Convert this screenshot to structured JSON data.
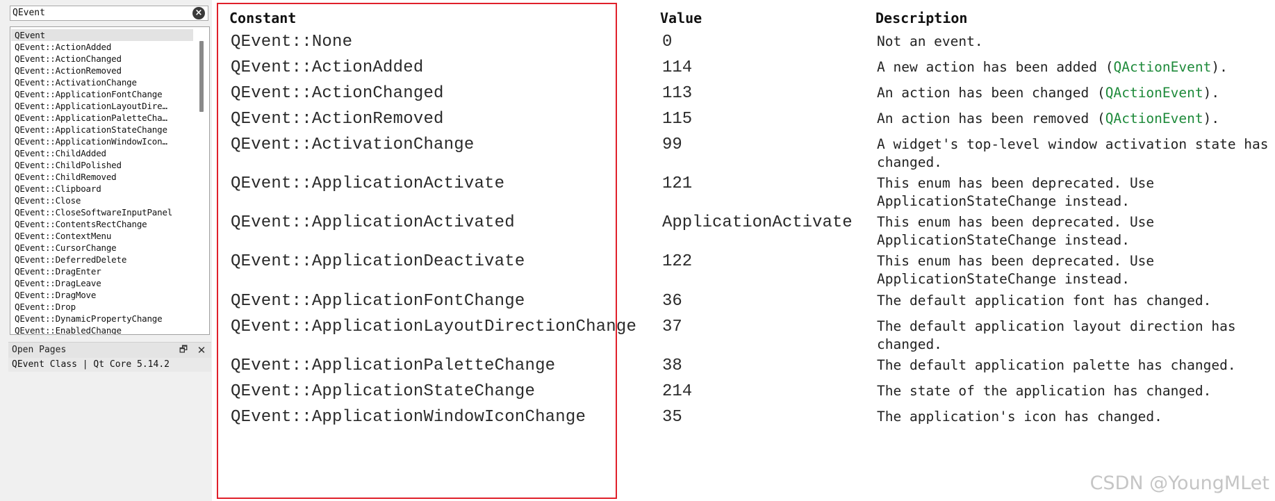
{
  "sidebar": {
    "search": {
      "value": "QEvent",
      "clear_icon": "×"
    },
    "index_items": [
      "QEvent",
      "QEvent::ActionAdded",
      "QEvent::ActionChanged",
      "QEvent::ActionRemoved",
      "QEvent::ActivationChange",
      "QEvent::ApplicationFontChange",
      "QEvent::ApplicationLayoutDire…",
      "QEvent::ApplicationPaletteCha…",
      "QEvent::ApplicationStateChange",
      "QEvent::ApplicationWindowIcon…",
      "QEvent::ChildAdded",
      "QEvent::ChildPolished",
      "QEvent::ChildRemoved",
      "QEvent::Clipboard",
      "QEvent::Close",
      "QEvent::CloseSoftwareInputPanel",
      "QEvent::ContentsRectChange",
      "QEvent::ContextMenu",
      "QEvent::CursorChange",
      "QEvent::DeferredDelete",
      "QEvent::DragEnter",
      "QEvent::DragLeave",
      "QEvent::DragMove",
      "QEvent::Drop",
      "QEvent::DynamicPropertyChange",
      "QEvent::EnabledChange"
    ],
    "open_pages": {
      "title": "Open Pages",
      "float_icon": "🗗",
      "close_icon": "✕",
      "items": [
        "QEvent Class | Qt Core 5.14.2"
      ]
    }
  },
  "table": {
    "headers": {
      "constant": "Constant",
      "value": "Value",
      "description": "Description"
    },
    "link_color": "#1e8a3a",
    "rows": [
      {
        "constant": "QEvent::None",
        "value": "0",
        "desc": [
          "Not an event."
        ]
      },
      {
        "constant": "QEvent::ActionAdded",
        "value": "114",
        "desc": [
          "A new action has been added (QActionEvent)."
        ],
        "link": "QActionEvent"
      },
      {
        "constant": "QEvent::ActionChanged",
        "value": "113",
        "desc": [
          "An action has been changed (QActionEvent)."
        ],
        "link": "QActionEvent"
      },
      {
        "constant": "QEvent::ActionRemoved",
        "value": "115",
        "desc": [
          "An action has been removed (QActionEvent)."
        ],
        "link": "QActionEvent"
      },
      {
        "constant": "QEvent::ActivationChange",
        "value": "99",
        "desc": [
          "A widget's top-level window activation state has",
          "changed."
        ]
      },
      {
        "constant": "QEvent::ApplicationActivate",
        "value": "121",
        "desc": [
          "This enum has been deprecated. Use",
          "ApplicationStateChange instead."
        ]
      },
      {
        "constant": "QEvent::ApplicationActivated",
        "value": "ApplicationActivate",
        "desc": [
          "This enum has been deprecated. Use",
          "ApplicationStateChange instead."
        ]
      },
      {
        "constant": "QEvent::ApplicationDeactivate",
        "value": "122",
        "desc": [
          "This enum has been deprecated. Use",
          "ApplicationStateChange instead."
        ]
      },
      {
        "constant": "QEvent::ApplicationFontChange",
        "value": "36",
        "desc": [
          "The default application font has changed."
        ]
      },
      {
        "constant": "QEvent::ApplicationLayoutDirectionChange",
        "value": "37",
        "desc": [
          "The default application layout direction has",
          "changed."
        ]
      },
      {
        "constant": "QEvent::ApplicationPaletteChange",
        "value": "38",
        "desc": [
          "The default application palette has changed."
        ]
      },
      {
        "constant": "QEvent::ApplicationStateChange",
        "value": "214",
        "desc": [
          "The state of the application has changed."
        ]
      },
      {
        "constant": "QEvent::ApplicationWindowIconChange",
        "value": "35",
        "desc": [
          "The application's icon has changed."
        ]
      }
    ]
  },
  "highlight_color": "#e0202a",
  "watermark": "CSDN @YoungMLet"
}
